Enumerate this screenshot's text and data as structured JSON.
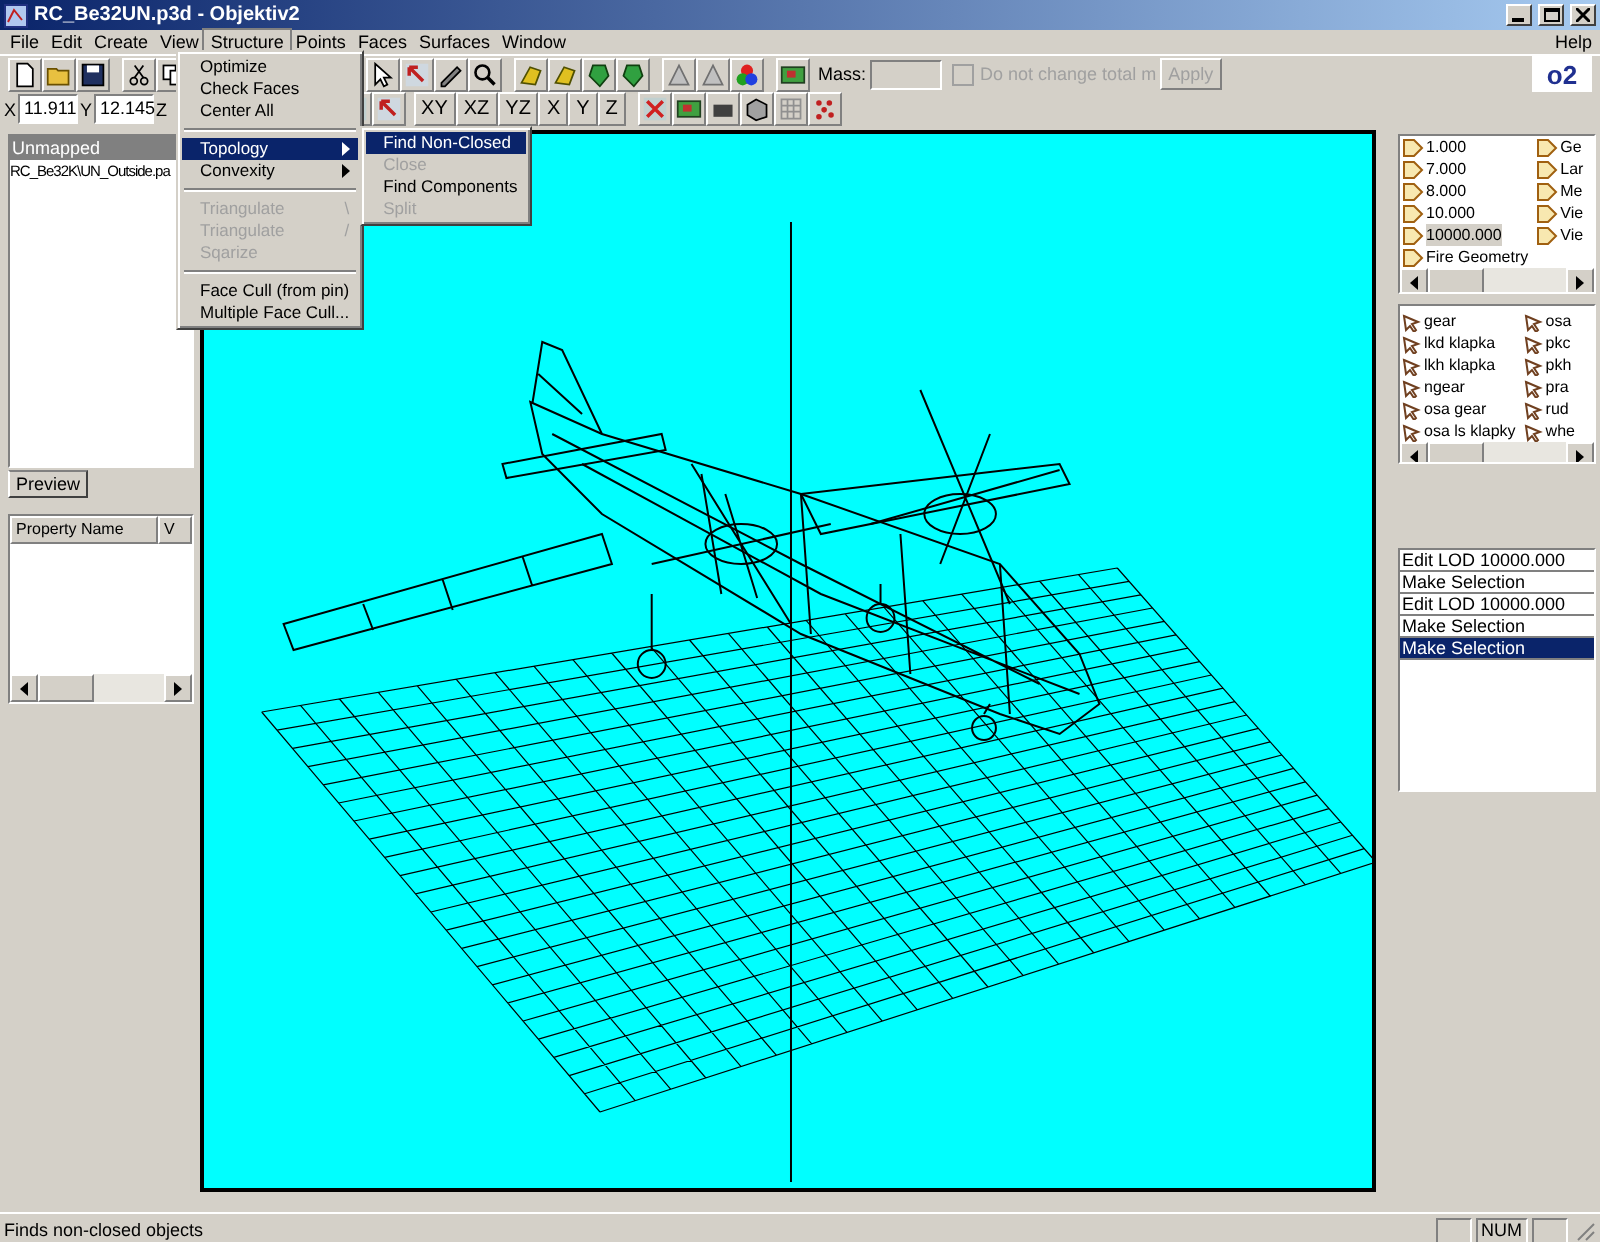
{
  "window": {
    "title": "RC_Be32UN.p3d - Objektiv2"
  },
  "menubar": {
    "items": [
      {
        "label": "File",
        "selected": false
      },
      {
        "label": "Edit",
        "selected": false
      },
      {
        "label": "Create",
        "selected": false
      },
      {
        "label": "View",
        "selected": false
      },
      {
        "label": "Structure",
        "selected": true
      },
      {
        "label": "Points",
        "selected": false
      },
      {
        "label": "Faces",
        "selected": false
      },
      {
        "label": "Surfaces",
        "selected": false
      },
      {
        "label": "Window",
        "selected": false
      }
    ],
    "help": "Help"
  },
  "structure_menu": {
    "items": [
      {
        "kind": "item",
        "label": "Optimize",
        "disabled": false,
        "selected": false,
        "submenu": false
      },
      {
        "kind": "item",
        "label": "Check Faces",
        "disabled": false,
        "selected": false,
        "submenu": false
      },
      {
        "kind": "item",
        "label": "Center All",
        "disabled": false,
        "selected": false,
        "submenu": false
      },
      {
        "kind": "separator"
      },
      {
        "kind": "item",
        "label": "Topology",
        "disabled": false,
        "selected": true,
        "submenu": true
      },
      {
        "kind": "item",
        "label": "Convexity",
        "disabled": false,
        "selected": false,
        "submenu": true
      },
      {
        "kind": "separator"
      },
      {
        "kind": "item",
        "label": "Triangulate",
        "shortcut": "\\",
        "disabled": true,
        "selected": false,
        "submenu": false
      },
      {
        "kind": "item",
        "label": "Triangulate",
        "shortcut": "/",
        "disabled": true,
        "selected": false,
        "submenu": false
      },
      {
        "kind": "item",
        "label": "Sqarize",
        "disabled": true,
        "selected": false,
        "submenu": false
      },
      {
        "kind": "separator"
      },
      {
        "kind": "item",
        "label": "Face Cull (from pin)",
        "disabled": false,
        "selected": false,
        "submenu": false
      },
      {
        "kind": "item",
        "label": "Multiple Face Cull...",
        "disabled": false,
        "selected": false,
        "submenu": false
      }
    ]
  },
  "topology_submenu": {
    "items": [
      {
        "label": "Find Non-Closed",
        "disabled": false,
        "selected": true
      },
      {
        "label": "Close",
        "disabled": true,
        "selected": false
      },
      {
        "label": "Find Components",
        "disabled": false,
        "selected": false
      },
      {
        "label": "Split",
        "disabled": true,
        "selected": false
      }
    ]
  },
  "toolbar": {
    "mass_label": "Mass:",
    "keep_mass": {
      "label": "Do not change total m",
      "checked": false,
      "disabled": true
    },
    "apply_button": {
      "label": "Apply",
      "disabled": true
    },
    "logo": "o2",
    "coordinates": [
      {
        "axis": "X",
        "value": "11.911"
      },
      {
        "axis": "Y",
        "value": "12.145"
      },
      {
        "axis": "Z"
      }
    ],
    "view_buttons": [
      "XY",
      "XZ",
      "YZ",
      "X",
      "Y",
      "Z"
    ]
  },
  "left_panel": {
    "list_header": "Unmapped",
    "items": [
      "RC_Be32K\\UN_Outside.pa"
    ],
    "tab": "Preview",
    "property_columns": [
      "Property Name",
      "V"
    ]
  },
  "right_panel": {
    "lods": {
      "column_1": [
        {
          "label": "1.000",
          "selected": false
        },
        {
          "label": "7.000",
          "selected": false
        },
        {
          "label": "8.000",
          "selected": false
        },
        {
          "label": "10.000",
          "selected": false
        },
        {
          "label": "10000.000",
          "selected": true
        },
        {
          "label": "Fire Geometry",
          "selected": false
        }
      ],
      "column_2": [
        {
          "label": "Ge",
          "selected": false
        },
        {
          "label": "Lar",
          "selected": false
        },
        {
          "label": "Me",
          "selected": false
        },
        {
          "label": "Vie",
          "selected": false
        },
        {
          "label": "Vie",
          "selected": false
        }
      ]
    },
    "selections": {
      "column_1": [
        "gear",
        "lkd klapka",
        "lkh klapka",
        "ngear",
        "osa gear",
        "osa ls klapky"
      ],
      "column_2": [
        "osa",
        "pkc",
        "pkh",
        "pra",
        "rud",
        "whe"
      ]
    },
    "history": [
      {
        "label": "Edit LOD 10000.000",
        "selected": false
      },
      {
        "label": "Make Selection",
        "selected": false
      },
      {
        "label": "Edit LOD 10000.000",
        "selected": false
      },
      {
        "label": "Make Selection",
        "selected": false
      },
      {
        "label": "Make Selection",
        "selected": true
      }
    ]
  },
  "status_bar": {
    "text": "Finds non-closed objects",
    "indicator": "NUM"
  }
}
